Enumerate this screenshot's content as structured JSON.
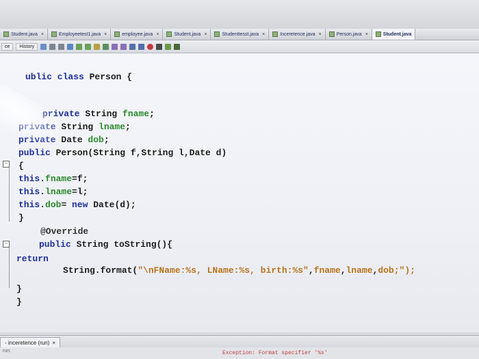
{
  "tabs": [
    {
      "label": "Student.java"
    },
    {
      "label": "Employeetest1.java"
    },
    {
      "label": "employee.java"
    },
    {
      "label": "Student.java"
    },
    {
      "label": "Studenttesst.java"
    },
    {
      "label": "Inceretence.java"
    },
    {
      "label": "Person.java"
    },
    {
      "label": "Student.java"
    }
  ],
  "toolbar": {
    "source_label": "ce",
    "history_label": "History"
  },
  "code": {
    "l1": {
      "kw": "ublic class",
      "rest": " Person {"
    },
    "l2": {
      "kw": "private",
      "type": " String ",
      "field": "fname",
      "end": ";"
    },
    "l3": {
      "kw": "private",
      "type": " String ",
      "field": "lname",
      "end": ";"
    },
    "l4": {
      "kw": "private",
      "type": " Date ",
      "field": "dob",
      "end": ";"
    },
    "l5": {
      "kw": "public",
      "rest": " Person(String f,String l,Date d)"
    },
    "l6": {
      "text": "{"
    },
    "l7": {
      "kw": "this",
      "dot": ".",
      "field": "fname",
      "rest": "=f;"
    },
    "l8": {
      "kw": "this",
      "dot": ".",
      "field": "lname",
      "rest": "=l;"
    },
    "l9": {
      "kw": "this",
      "dot": ".",
      "field": "dob",
      "rest": "= ",
      "kw2": "new",
      "rest2": " Date(d);"
    },
    "l10": {
      "text": "}"
    },
    "l11": {
      "text": "@Override"
    },
    "l12": {
      "kw": "public",
      "rest": " String toString(){"
    },
    "l13": {
      "kw": "return"
    },
    "l14": {
      "pre": "String.format(",
      "str": "\"\\nFName:%s, LName:%s, birth:%s\"",
      "mid": ",",
      "f1": "fname",
      "c1": ",",
      "f2": "lname",
      "c2": ",",
      "f3": "dob",
      "end": ";\");"
    },
    "l15": {
      "text": "}"
    },
    "l16": {
      "text": "}"
    }
  },
  "output": {
    "tab_label": "- inceretence (run)",
    "close": "×",
    "run_label": "run:",
    "error_text": "Exception: Format specifier '%s'"
  }
}
